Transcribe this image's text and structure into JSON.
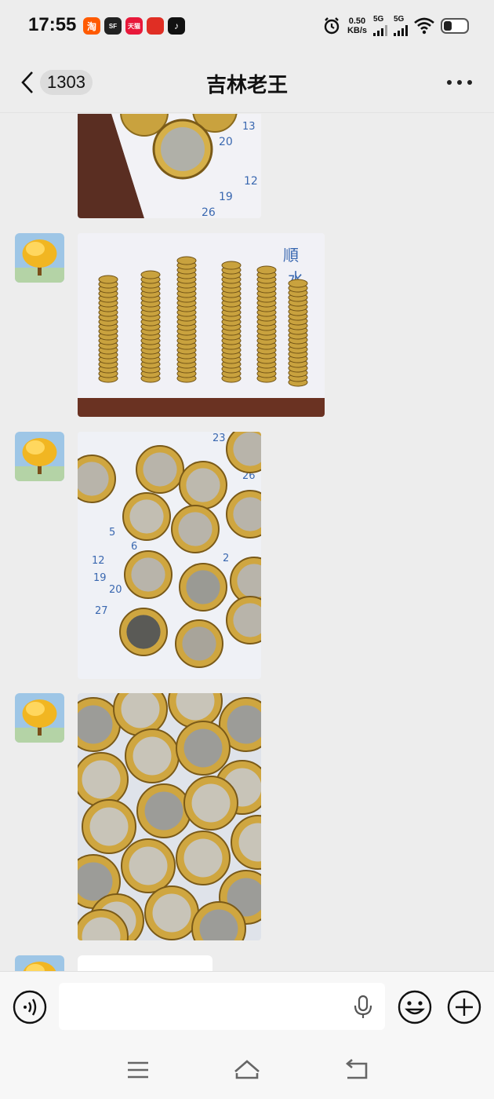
{
  "status_bar": {
    "time": "17:55",
    "network_speed_value": "0.50",
    "network_speed_unit": "KB/s",
    "signal_1": "5G",
    "signal_2": "5G",
    "apps": [
      {
        "name": "taobao-icon",
        "label": "淘",
        "color": "#ff5a00"
      },
      {
        "name": "sf-express-icon",
        "label": "SF",
        "color": "#222222"
      },
      {
        "name": "tmall-icon",
        "label": "天猫",
        "color": "#e8183a"
      },
      {
        "name": "pinduoduo-icon",
        "label": "",
        "color": "#e02e24"
      },
      {
        "name": "douyin-icon",
        "label": "♪",
        "color": "#111111"
      }
    ],
    "icons": [
      "alarm-icon",
      "wifi-icon",
      "battery-icon"
    ]
  },
  "header": {
    "unread_count": "1303",
    "title": "吉林老王",
    "icons": [
      "back-chevron-icon",
      "more-dots-icon"
    ]
  },
  "messages": [
    {
      "type": "image",
      "content": "coins-on-calendar-cropped"
    },
    {
      "type": "image",
      "content": "coin-stacks-in-rows"
    },
    {
      "type": "image",
      "content": "coins-spread-on-calendar"
    },
    {
      "type": "image",
      "content": "coin-pile-closeup"
    },
    {
      "type": "text",
      "content": ""
    }
  ],
  "input_bar": {
    "text_value": "",
    "icons": [
      "voice-mode-icon",
      "microphone-icon",
      "emoji-icon",
      "plus-icon"
    ]
  },
  "nav_bar": {
    "icons": [
      "menu-icon",
      "home-icon",
      "back-nav-icon"
    ]
  },
  "colors": {
    "background": "#ededed",
    "bubble": "#ffffff",
    "coin_gold": "#c9a23e",
    "calendar_blue": "#3a68b0"
  }
}
